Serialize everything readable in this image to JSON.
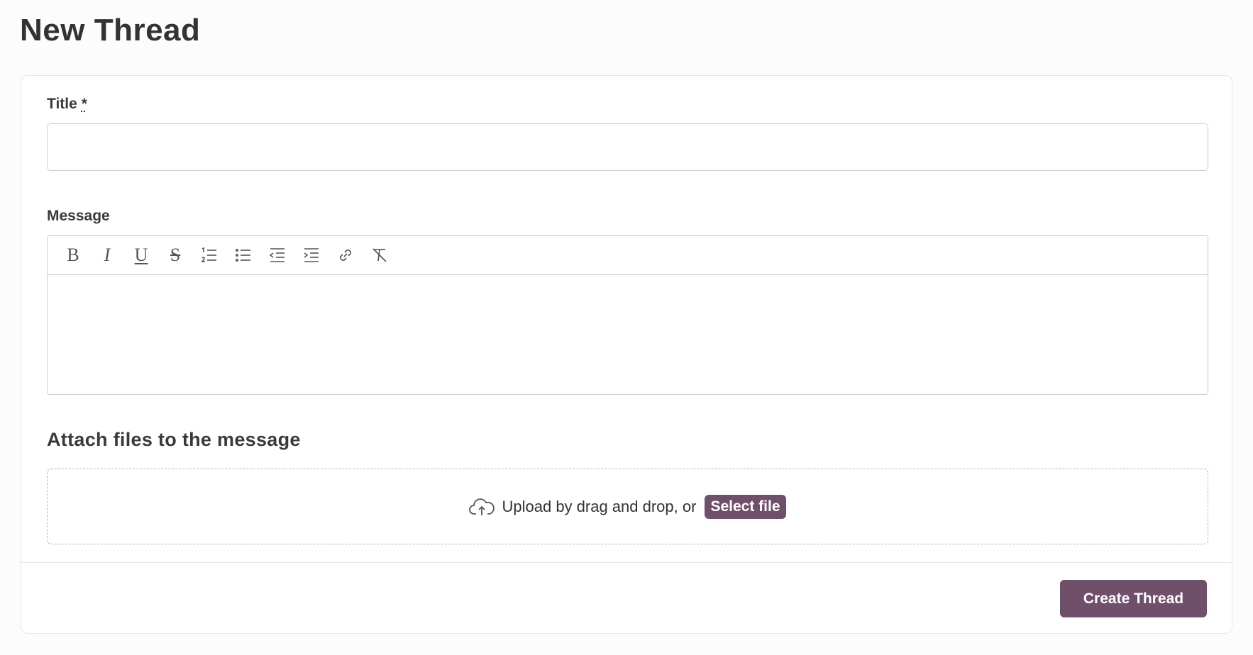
{
  "page": {
    "title": "New Thread"
  },
  "form": {
    "title_label": "Title",
    "required_marker": "*",
    "title_value": "",
    "message_label": "Message",
    "message_value": "",
    "toolbar": [
      {
        "name": "bold-icon",
        "glyph": "B"
      },
      {
        "name": "italic-icon",
        "glyph": "I"
      },
      {
        "name": "underline-icon",
        "glyph": "U"
      },
      {
        "name": "strikethrough-icon",
        "glyph": "S"
      },
      {
        "name": "ordered-list-icon"
      },
      {
        "name": "bullet-list-icon"
      },
      {
        "name": "outdent-icon"
      },
      {
        "name": "indent-icon"
      },
      {
        "name": "link-icon"
      },
      {
        "name": "clear-formatting-icon"
      }
    ]
  },
  "attachments": {
    "heading": "Attach files to the message",
    "upload_text": "Upload by drag and drop, or",
    "select_file_label": "Select file",
    "icon": "cloud-upload-icon"
  },
  "actions": {
    "create_label": "Create Thread"
  },
  "colors": {
    "accent": "#704f6b",
    "border": "#cfcfcf",
    "card_bg": "#ffffff",
    "page_bg": "#fcfcfc"
  }
}
